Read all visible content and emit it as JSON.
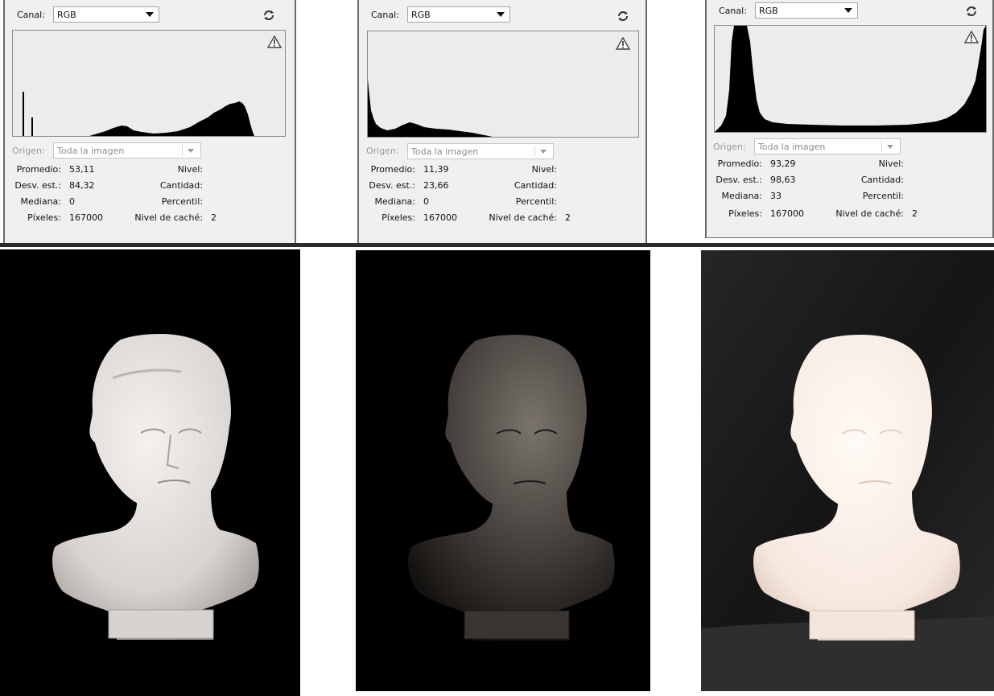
{
  "panels": [
    {
      "canal_label": "Canal:",
      "canal_value": "RGB",
      "origen_label": "Origen:",
      "origen_value": "Toda la imagen",
      "stats": {
        "promedio_label": "Promedio:",
        "promedio": "53,11",
        "desv_label": "Desv. est.:",
        "desv": "84,32",
        "mediana_label": "Mediana:",
        "mediana": "0",
        "pixeles_label": "Píxeles:",
        "pixeles": "167000",
        "nivel_label": "Nivel:",
        "cantidad_label": "Cantidad:",
        "percentil_label": "Percentil:",
        "cache_label": "Nivel de caché:",
        "cache": "2"
      }
    },
    {
      "canal_label": "Canal:",
      "canal_value": "RGB",
      "origen_label": "Origen:",
      "origen_value": "Toda la imagen",
      "stats": {
        "promedio_label": "Promedio:",
        "promedio": "11,39",
        "desv_label": "Desv. est.:",
        "desv": "23,66",
        "mediana_label": "Mediana:",
        "mediana": "0",
        "pixeles_label": "Píxeles:",
        "pixeles": "167000",
        "nivel_label": "Nivel:",
        "cantidad_label": "Cantidad:",
        "percentil_label": "Percentil:",
        "cache_label": "Nivel de caché:",
        "cache": "2"
      }
    },
    {
      "canal_label": "Canal:",
      "canal_value": "RGB",
      "origen_label": "Origen:",
      "origen_value": "Toda la imagen",
      "stats": {
        "promedio_label": "Promedio:",
        "promedio": "93,29",
        "desv_label": "Desv. est.:",
        "desv": "98,63",
        "mediana_label": "Mediana:",
        "mediana": "33",
        "pixeles_label": "Píxeles:",
        "pixeles": "167000",
        "nivel_label": "Nivel:",
        "cantidad_label": "Cantidad:",
        "percentil_label": "Percentil:",
        "cache_label": "Nivel de caché:",
        "cache": "2"
      }
    }
  ],
  "icons": {
    "refresh": "refresh-icon",
    "warning": "warning-triangle-icon",
    "dropdown": "chevron-down-icon"
  },
  "photos": [
    {
      "exposure": "normal",
      "background": "#000000"
    },
    {
      "exposure": "underexposed",
      "background": "#000000"
    },
    {
      "exposure": "overexposed",
      "background": "#1c1c1c"
    }
  ]
}
